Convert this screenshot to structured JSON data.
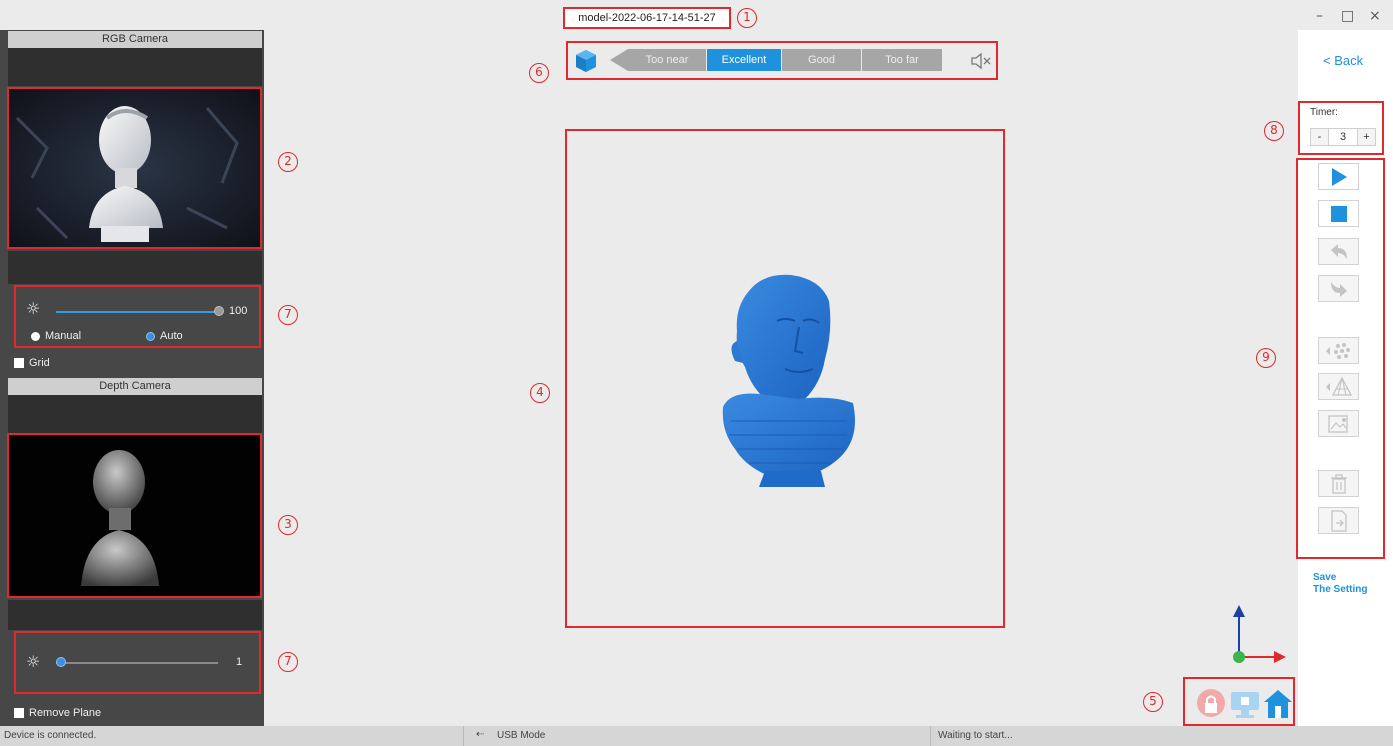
{
  "window": {
    "title": "model-2022-06-17-14-51-27",
    "minimize": "–",
    "maximize": "□",
    "close": "×"
  },
  "callouts": [
    "1",
    "2",
    "3",
    "4",
    "5",
    "6",
    "7",
    "7",
    "8",
    "9"
  ],
  "rgb_camera": {
    "header": "RGB Camera",
    "brightness_value": "100",
    "brightness_level": 1.0,
    "mode_options": [
      "Manual",
      "Auto"
    ],
    "selected_mode": "Auto",
    "grid_label": "Grid"
  },
  "depth_camera": {
    "header": "Depth Camera",
    "brightness_value": "1",
    "brightness_level": 0.0,
    "remove_plane_label": "Remove Plane"
  },
  "distance": {
    "segments": [
      "Too near",
      "Excellent",
      "Good",
      "Too far"
    ],
    "active": "Excellent",
    "mute_icon": "speaker-mute-icon"
  },
  "right_panel": {
    "back_label": "< Back",
    "timer_label": "Timer:",
    "timer_value": "3",
    "minus": "-",
    "plus": "+",
    "save_setting_line1": "Save",
    "save_setting_line2": "The Setting",
    "tools": [
      "play-icon",
      "stop-icon",
      "undo-icon",
      "redo-icon",
      "point-cloud-icon",
      "mesh-icon",
      "texture-icon",
      "delete-icon",
      "export-icon"
    ]
  },
  "status": {
    "left": "Device is connected.",
    "usb_icon": "usb-icon",
    "middle": "USB Mode",
    "right": "Waiting to start..."
  },
  "colors": {
    "accent": "#1f91dd",
    "model_blue": "#2e7bd6",
    "callout_red": "#e0282d",
    "panel_dark": "#474747"
  }
}
